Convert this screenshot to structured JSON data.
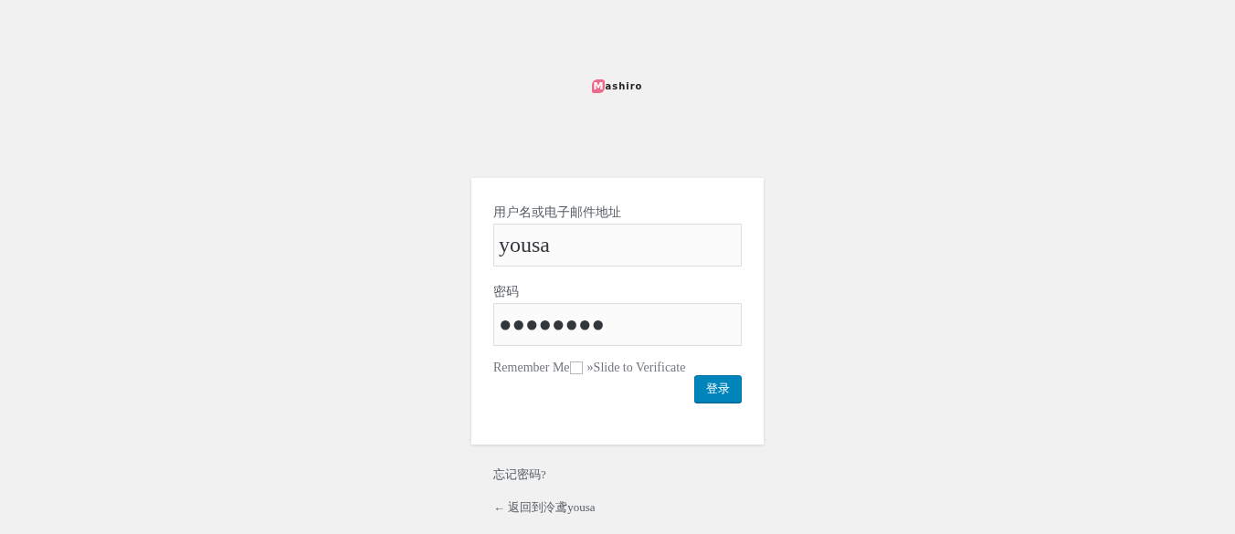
{
  "logo": {
    "initial": "M",
    "rest": "ashiro"
  },
  "form": {
    "username_label": "用户名或电子邮件地址",
    "username_value": "yousa",
    "password_label": "密码",
    "password_value": "●●●●●●●●",
    "remember_label": "Remember Me",
    "remember_checked": false,
    "slide_text": "»Slide to Verificate",
    "submit": "登录"
  },
  "links": [
    {
      "text": "忘记密码?"
    },
    {
      "text": "← 返回到泠鸢yousa"
    }
  ]
}
